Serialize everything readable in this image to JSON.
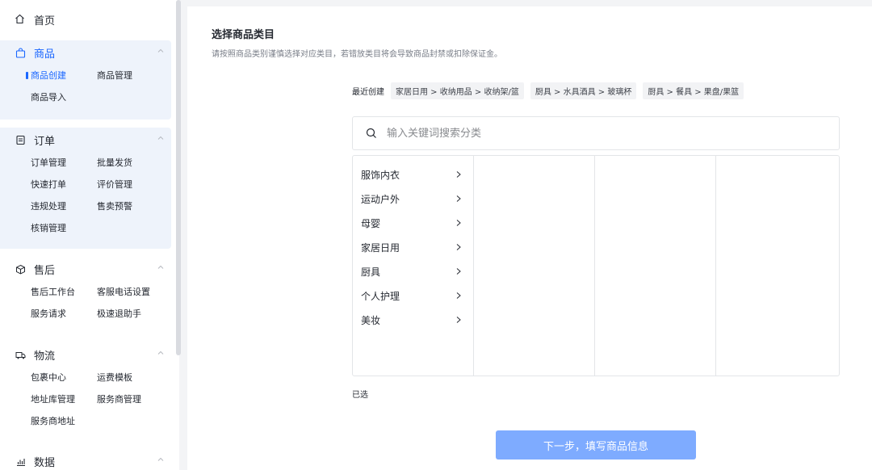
{
  "sidebar": {
    "home": "首页",
    "groups": [
      {
        "title": "商品",
        "icon": "bag-icon",
        "items": [
          "商品创建",
          "商品管理",
          "商品导入"
        ]
      },
      {
        "title": "订单",
        "icon": "order-icon",
        "items": [
          "订单管理",
          "批量发货",
          "快速打单",
          "评价管理",
          "违规处理",
          "售卖预警",
          "核销管理"
        ]
      },
      {
        "title": "售后",
        "icon": "box-icon",
        "items": [
          "售后工作台",
          "客服电话设置",
          "服务请求",
          "极速退助手"
        ]
      },
      {
        "title": "物流",
        "icon": "truck-icon",
        "items": [
          "包裹中心",
          "运费模板",
          "地址库管理",
          "服务商管理",
          "服务商地址"
        ]
      },
      {
        "title": "数据",
        "icon": "chart-icon",
        "items": []
      }
    ]
  },
  "main": {
    "title": "选择商品类目",
    "subtitle": "请按照商品类别谨慎选择对应类目，若错放类目将会导致商品封禁或扣除保证金。",
    "recent_label": "最近创建",
    "recent": [
      "家居日用 > 收纳用品 > 收纳架/篮",
      "厨具 > 水具酒具 > 玻璃杯",
      "厨具 > 餐具 > 果盘/果篮"
    ],
    "search_placeholder": "输入关键词搜索分类",
    "categories": [
      "服饰内衣",
      "运动户外",
      "母婴",
      "家居日用",
      "厨具",
      "个人护理",
      "美妆"
    ],
    "selected_label": "已选",
    "next_button": "下一步，填写商品信息"
  },
  "colors": {
    "accent": "#1966ff",
    "button_disabled": "#7eabff",
    "active_group_bg": "#eef3fb"
  }
}
